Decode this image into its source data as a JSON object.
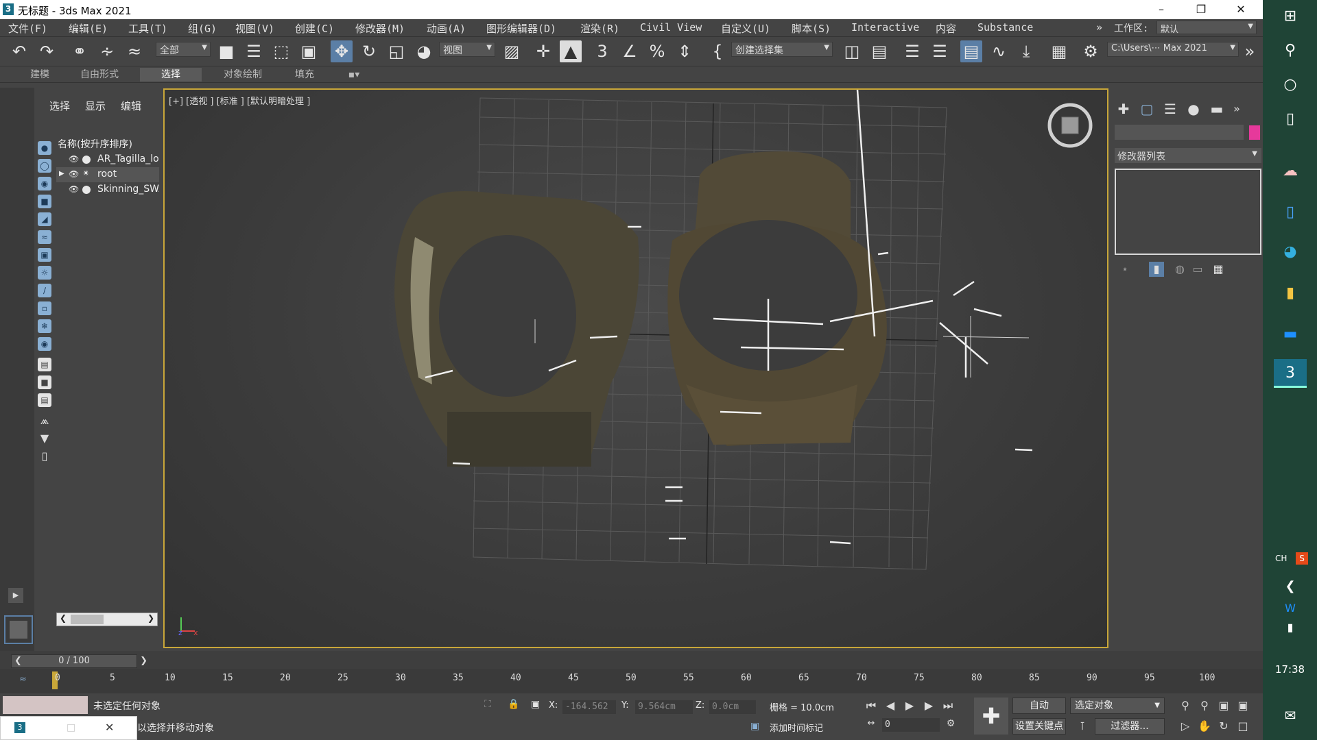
{
  "window": {
    "title": "无标题 - 3ds Max 2021",
    "app_icon": "3"
  },
  "menu": [
    "文件(F)",
    "编辑(E)",
    "工具(T)",
    "组(G)",
    "视图(V)",
    "创建(C)",
    "修改器(M)",
    "动画(A)",
    "图形编辑器(D)",
    "渲染(R)",
    "Civil View",
    "自定义(U)",
    "脚本(S)",
    "Interactive",
    "内容",
    "Substance"
  ],
  "workspace": {
    "label": "工作区:",
    "value": "默认"
  },
  "toolbar": {
    "filter": "全部",
    "refcoord": "视图",
    "selset": "创建选择集",
    "path": "C:\\Users\\⋯ Max 2021"
  },
  "ribbon": [
    "建模",
    "自由形式",
    "选择",
    "对象绘制",
    "填充"
  ],
  "explorer": {
    "tabs": [
      "选择",
      "显示",
      "编辑"
    ],
    "header": "名称(按升序排序)",
    "items": [
      "AR_Tagilla_lo",
      "root",
      "Skinning_SWA"
    ]
  },
  "viewport": {
    "label": "[+] [透视 ] [标准 ] [默认明暗处理 ]"
  },
  "modify": {
    "modifier_list": "修改器列表",
    "color": "#e6399b"
  },
  "time": {
    "slider": "0 / 100",
    "ticks": [
      "0",
      "5",
      "10",
      "15",
      "20",
      "25",
      "30",
      "35",
      "40",
      "45",
      "50",
      "55",
      "60",
      "65",
      "70",
      "75",
      "80",
      "85",
      "90",
      "95",
      "100"
    ]
  },
  "status": {
    "msg1": "未选定任何对象",
    "msg2": "动以选择并移动对象",
    "x_label": "X:",
    "x": "-164.562",
    "y_label": "Y:",
    "y": "9.564cm",
    "z_label": "Z:",
    "z": "0.0cm",
    "grid": "栅格 = 10.0cm",
    "add_time_tag": "添加时间标记",
    "auto": "自动",
    "set_key": "设置关键点",
    "sel_obj": "选定对象",
    "filters": "过滤器...",
    "frame": "0"
  },
  "taskbar": {
    "lang": "CH",
    "ime": "S",
    "time": "17:38"
  }
}
